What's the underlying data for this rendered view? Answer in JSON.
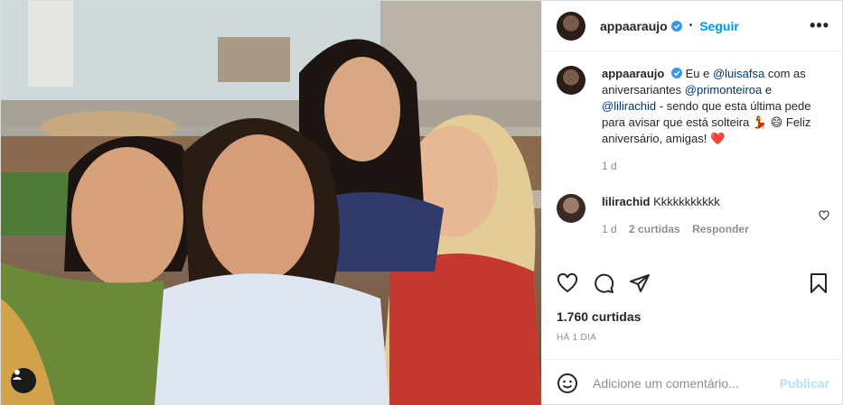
{
  "post": {
    "author": "appaaraujo",
    "follow_label": "Seguir",
    "more_label": "•••",
    "separator": "•"
  },
  "caption": {
    "author": "appaaraujo",
    "parts": [
      {
        "text": "Eu e ",
        "mention": false
      },
      {
        "text": "@luisafsa",
        "mention": true
      },
      {
        "text": " com as aniversariantes ",
        "mention": false
      },
      {
        "text": "@primonteiroa",
        "mention": true
      },
      {
        "text": " e ",
        "mention": false
      },
      {
        "text": "@lilirachid",
        "mention": true
      },
      {
        "text": " - sendo que esta última pede para avisar que está solteira 💃 😄 Feliz aniversário, amigas! ❤️",
        "mention": false
      }
    ],
    "time": "1 d"
  },
  "comment": {
    "author": "lilirachid",
    "text": "Kkkkkkkkkkk",
    "time": "1 d",
    "likes": "2 curtidas",
    "reply_label": "Responder"
  },
  "likes_label": "1.760 curtidas",
  "posted_ago": "HÁ 1 DIA",
  "add_comment": {
    "placeholder": "Adicione um comentário...",
    "publish_label": "Publicar"
  },
  "icons": {
    "verified": "verified-badge-icon",
    "like": "heart-icon",
    "comment": "comment-icon",
    "share": "share-icon",
    "save": "bookmark-icon",
    "emoji": "emoji-icon",
    "tags": "user-tag-icon"
  },
  "colors": {
    "accent": "#0095f6",
    "publish_disabled": "#b2dffc",
    "mention": "#00376b",
    "muted": "#8e8e8e"
  }
}
